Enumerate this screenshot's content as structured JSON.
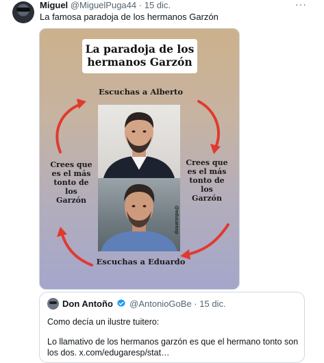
{
  "tweet": {
    "author_name": "Miguel",
    "author_handle": "@MiguelPuga44",
    "separator": "·",
    "date": "15 dic.",
    "more": "···",
    "text": "La famosa paradoja de los hermanos Garzón"
  },
  "meme": {
    "title_line1": "La paradoja de los",
    "title_line2": "hermanos Garzón",
    "top_label": "Escuchas a Alberto",
    "bottom_label": "Escuchas a Eduardo",
    "side_label_lines": [
      "Crees que",
      "es el más",
      "tonto de",
      "los",
      "Garzón"
    ],
    "watermark": "@educaresp",
    "arrow_color": "#e03a2f"
  },
  "quote": {
    "author_name": "Don Antoño",
    "author_handle": "@AntonioGoBe",
    "separator": "·",
    "date": "15 dic.",
    "line1": "Como decía un ilustre tuitero:",
    "line2": "Lo llamativo de los hermanos garzón es que el hermano tonto son los dos. x.com/edugaresp/stat…",
    "verified_color": "#1d9bf0"
  }
}
